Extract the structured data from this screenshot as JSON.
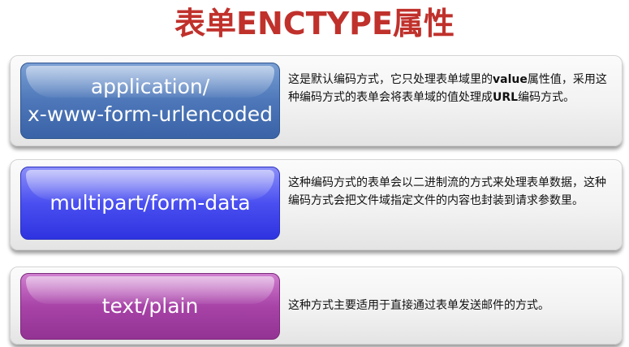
{
  "title": "表单ENCTYPE属性",
  "rows": [
    {
      "label_line1": "application/",
      "label_line2": "x-www-form-urlencoded",
      "desc_part1": "这是默认编码方式，它只处理表单域里的",
      "desc_bold1": "value",
      "desc_part2": "属性值，采用这种编码方式的表单会将表单域的值处理成",
      "desc_bold2": "URL",
      "desc_part3": "编码方式。",
      "color": "#4d77b9"
    },
    {
      "label": "multipart/form-data",
      "desc": "这种编码方式的表单会以二进制流的方式来处理表单数据，这种编码方式会把文件域指定文件的内容也封装到请求参数里。",
      "color": "#4a4ff0"
    },
    {
      "label": "text/plain",
      "desc": "这种方式主要适用于直接通过表单发送邮件的方式。",
      "color": "#a843a8"
    }
  ]
}
